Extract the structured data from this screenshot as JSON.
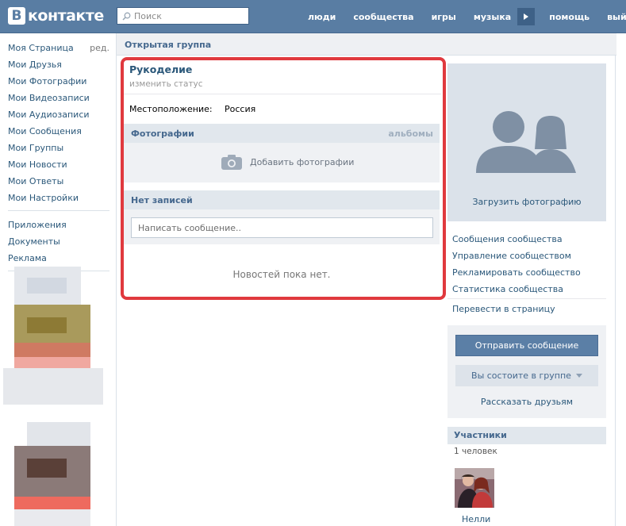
{
  "header": {
    "logo_letter": "В",
    "logo_text": "контакте",
    "search_placeholder": "Поиск",
    "nav": [
      "люди",
      "сообщества",
      "игры",
      "музыка",
      "помощь",
      "выйти"
    ]
  },
  "sidebar": {
    "edit_label": "ред.",
    "items": [
      "Моя Страница",
      "Мои Друзья",
      "Мои Фотографии",
      "Мои Видеозаписи",
      "Мои Аудиозаписи",
      "Мои Сообщения",
      "Мои Группы",
      "Мои Новости",
      "Мои Ответы",
      "Мои Настройки"
    ],
    "extra_items": [
      "Приложения",
      "Документы",
      "Реклама"
    ]
  },
  "breadcrumb": "Открытая группа",
  "group": {
    "name": "Рукоделие",
    "status_link": "изменить статус",
    "location_label": "Местоположение:",
    "location_value": "Россия"
  },
  "photos": {
    "title": "Фотографии",
    "albums_link": "альбомы",
    "add_label": "Добавить фотографии"
  },
  "wall": {
    "title": "Нет записей",
    "input_placeholder": "Написать сообщение..",
    "empty_text": "Новостей пока нет."
  },
  "right": {
    "upload_label": "Загрузить фотографию",
    "admin_links": [
      "Сообщения сообщества",
      "Управление сообществом",
      "Рекламировать сообщество",
      "Статистика сообщества"
    ],
    "transfer_link": "Перевести в страницу",
    "send_message": "Отправить сообщение",
    "membership": "Вы состоите в группе",
    "tell_friends": "Рассказать друзьям",
    "members_title": "Участники",
    "members_count": "1 человек",
    "member_name": "Нелли"
  },
  "colors": {
    "header_bg": "#597da3",
    "link": "#2b587a",
    "highlight": "#e0393e",
    "primary_button": "#5b7fa6"
  }
}
